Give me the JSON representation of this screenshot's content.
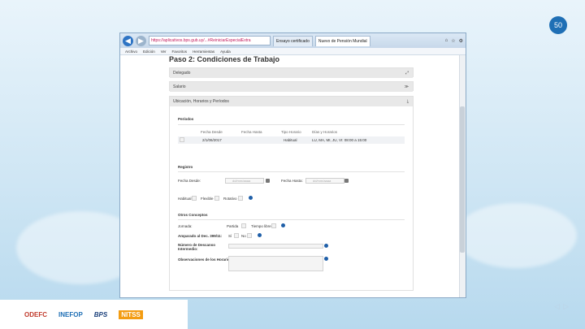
{
  "slide": {
    "page_number": "50"
  },
  "browser": {
    "address_url": "https://aplicativos.bps.gub.uy/...#ReiniciarEspecialExtra",
    "tabs": [
      "Ensayo certificado",
      "Nuevo de Pensión Mundial"
    ],
    "menu": [
      "Archivo",
      "Edición",
      "Ver",
      "Favoritos",
      "Herramientas",
      "Ayuda"
    ]
  },
  "form": {
    "step_title": "Paso 2: Condiciones de Trabajo",
    "sections": [
      {
        "label": "Delegado",
        "icon": "⤢"
      },
      {
        "label": "Salario",
        "icon": "≫"
      },
      {
        "label": "Ubicación, Horarios y Períodos",
        "icon": "⤓"
      }
    ],
    "periods": {
      "title": "Períodos",
      "columns": [
        "Fecha Desde",
        "Fecha Hasta",
        "Tipo Horario",
        "Días y Horarios"
      ],
      "rows": [
        {
          "desde": "2/1/06/2017",
          "hasta": "",
          "tipo": "Habitual",
          "dias": "LU, MA, MI, JU, VI: 08:00 a 15:00"
        }
      ]
    },
    "registro": {
      "title": "Registro",
      "fecha_desde_label": "Fecha Desde:",
      "fecha_hasta_label": "Fecha Hasta:",
      "date_placeholder": "dd/mm/aaaa",
      "habitual_label": "Habitual",
      "flexible_label": "Flexible",
      "rotativo_label": "Rotativo"
    },
    "otros": {
      "title": "Otros Conceptos",
      "jornada_label": "Jornada:",
      "partida_label": "Partida",
      "tiempo_libre_label": "Tiempo libre",
      "amparado_label": "Amparado al Dec. 399/11:",
      "si_label": "Sí",
      "no_label": "No",
      "numero_label": "Número de Descanso Intermedio:",
      "observ_label": "Observaciones de los Horarios:"
    }
  },
  "logos": [
    "ODEFC",
    "INEFOP",
    "BPS",
    "NITSS"
  ],
  "colors": {
    "accent": "#1f6fb5",
    "help": "#1f5fa8"
  }
}
